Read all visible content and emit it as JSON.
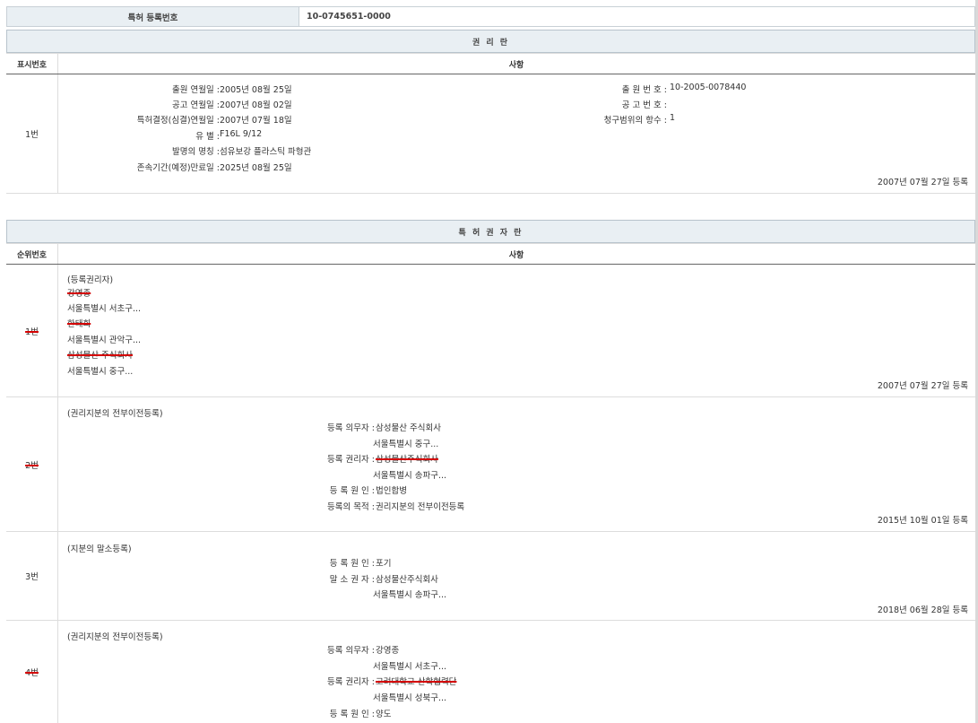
{
  "top": {
    "label": "특허 등록번호",
    "value": "10-0745651-0000"
  },
  "rights_section": {
    "title": "권 리 란",
    "col1": "표시번호",
    "col2": "사항",
    "row": {
      "num": "1번",
      "left_fields": [
        {
          "label": "출원 연월일 :",
          "value": "2005년 08월 25일"
        },
        {
          "label": "공고 연월일 :",
          "value": "2007년 08월 02일"
        },
        {
          "label": "특허결정(심결)연월일 :",
          "value": "2007년 07월 18일"
        },
        {
          "label": "유 별 :",
          "value": "F16L 9/12"
        },
        {
          "label": "발명의 명칭 :",
          "value": "섬유보강 플라스틱 파형관"
        },
        {
          "label": "존속기간(예정)만료일 :",
          "value": "2025년 08월 25일"
        }
      ],
      "right_fields": [
        {
          "label": "출 원 번 호 :",
          "value": "10-2005-0078440"
        },
        {
          "label": "공 고 번 호 :",
          "value": ""
        },
        {
          "label": "청구범위의 항수 :",
          "value": "1"
        }
      ],
      "date": "2007년 07월 27일 등록"
    }
  },
  "holder_section": {
    "title": "특 허 권 자 란",
    "col1": "순위번호",
    "col2": "사항",
    "rows": [
      {
        "num": "1번",
        "title": "(등록권리자)",
        "lines": [
          "강영종",
          "서울특별시 서초구...",
          "한태희",
          "서울특별시 관악구...",
          "삼성물산 주식회사",
          "서울특별시 중구..."
        ],
        "date": "2007년 07월 27일 등록"
      },
      {
        "num": "2번",
        "title": "(권리지분의 전부이전등록)",
        "fields": [
          {
            "label": "등록 의무자 :",
            "value": "삼성물산 주식회사"
          },
          {
            "label": "",
            "value": "서울특별시 중구..."
          },
          {
            "label": "등록 권리자 :",
            "value": "삼성물산주식회사"
          },
          {
            "label": "",
            "value": "서울특별시 송파구..."
          },
          {
            "label": "등 록 원 인 :",
            "value": "법인합병"
          },
          {
            "label": "등록의 목적 :",
            "value": "권리지분의 전부이전등록"
          }
        ],
        "date": "2015년 10월 01일 등록"
      },
      {
        "num": "3번",
        "title": "(지분의 말소등록)",
        "fields": [
          {
            "label": "등 록 원 인 :",
            "value": "포기"
          },
          {
            "label": "말 소 권 자 :",
            "value": "삼성물산주식회사"
          },
          {
            "label": "",
            "value": "서울특별시 송파구..."
          }
        ],
        "date": "2018년 06월 28일 등록"
      },
      {
        "num": "4번",
        "title": "(권리지분의 전부이전등록)",
        "fields": [
          {
            "label": "등록 의무자 :",
            "value": "강영종"
          },
          {
            "label": "",
            "value": "서울특별시 서초구..."
          },
          {
            "label": "등록 권리자 :",
            "value": "고려대학교 산학협력단"
          },
          {
            "label": "",
            "value": "서울특별시 성북구..."
          },
          {
            "label": "등 록 원 인 :",
            "value": "양도"
          }
        ]
      }
    ]
  }
}
